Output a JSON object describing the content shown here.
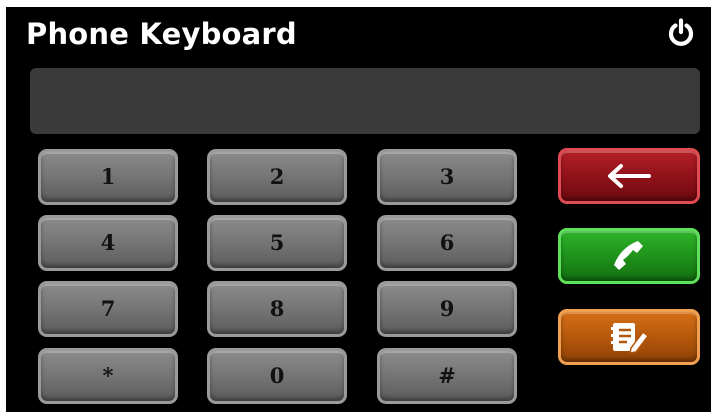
{
  "header": {
    "title": "Phone Keyboard",
    "power_icon": "power-icon"
  },
  "display": {
    "value": ""
  },
  "keypad": {
    "keys": [
      "1",
      "2",
      "3",
      "4",
      "5",
      "6",
      "7",
      "8",
      "9",
      "*",
      "0",
      "#"
    ]
  },
  "actions": {
    "backspace_icon": "left-arrow-icon",
    "call_icon": "phone-handset-icon",
    "contacts_icon": "address-book-icon",
    "colors": {
      "backspace": "#a3161e",
      "call": "#22a01d",
      "contacts": "#c4620f"
    }
  }
}
